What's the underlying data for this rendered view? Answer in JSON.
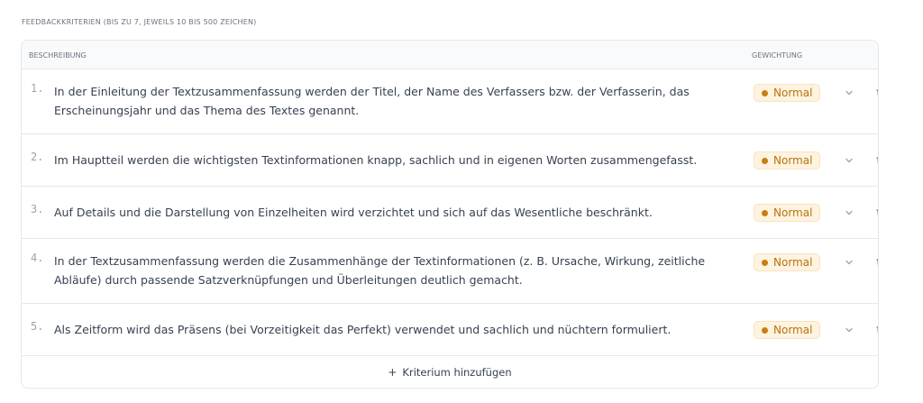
{
  "section_label": "FEEDBACKKRITERIEN (BIS ZU 7, JEWEILS 10 BIS 500 ZEICHEN)",
  "table": {
    "headers": {
      "description": "BESCHREIBUNG",
      "weight": "GEWICHTUNG"
    },
    "rows": [
      {
        "number": "1.",
        "text": "In der Einleitung der Textzusammenfassung werden der Titel, der Name des Verfassers bzw. der Verfasserin, das Erscheinungsjahr und das Thema des Textes genannt.",
        "weight": "Normal"
      },
      {
        "number": "2.",
        "text": "Im Hauptteil werden die wichtigsten Textinformationen knapp, sachlich und in eigenen Worten zusammengefasst.",
        "weight": "Normal"
      },
      {
        "number": "3.",
        "text": "Auf Details und die Darstellung von Einzelheiten wird verzichtet und sich auf das Wesentliche beschränkt.",
        "weight": "Normal"
      },
      {
        "number": "4.",
        "text": "In der Textzusammenfassung werden die Zusammenhänge der Textinformationen (z. B. Ursache, Wirkung, zeitliche Abläufe) durch passende Satzverknüpfungen und Überleitungen deutlich gemacht.",
        "weight": "Normal"
      },
      {
        "number": "5.",
        "text": "Als Zeitform wird das Präsens (bei Vorzeitigkeit das Perfekt) verwendet und sachlich und nüchtern formuliert.",
        "weight": "Normal"
      }
    ],
    "add_label": "Kriterium hinzufügen",
    "add_icon": "+"
  },
  "colors": {
    "weight_badge_bg": "#fdf3e0",
    "weight_badge_text": "#b8740b",
    "weight_dot": "#c77f0f"
  },
  "icons": {
    "expand": "chevron-down-icon",
    "delete": "trash-icon"
  }
}
